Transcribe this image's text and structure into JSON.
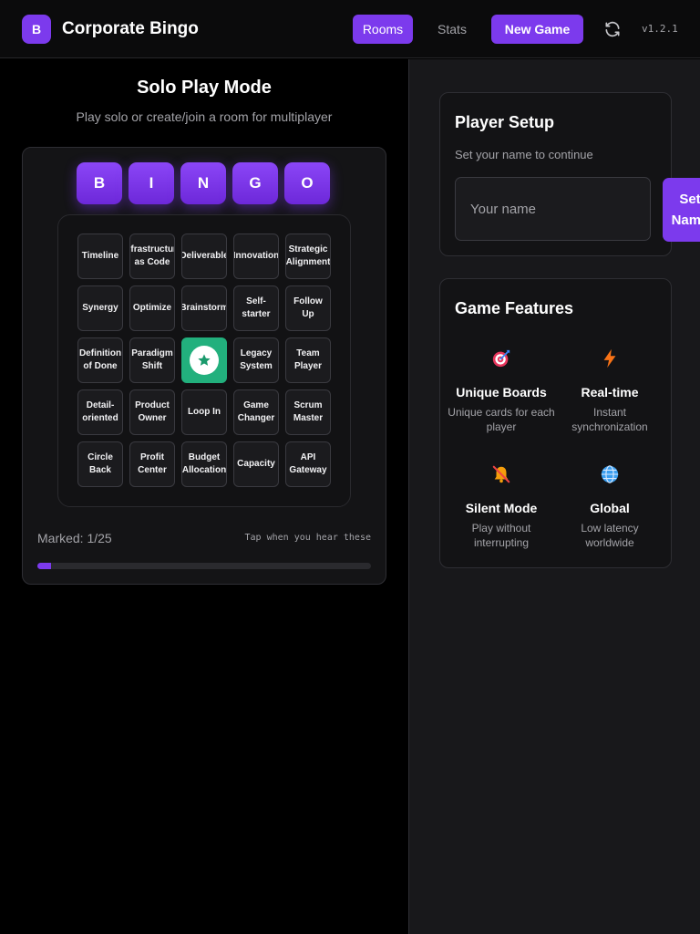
{
  "header": {
    "logo_letter": "B",
    "app_title": "Corporate Bingo",
    "nav_rooms": "Rooms",
    "nav_stats": "Stats",
    "new_game": "New Game",
    "refresh_icon": "refresh-icon",
    "version": "v1.2.1"
  },
  "solo": {
    "title": "Solo Play Mode",
    "subtitle": "Play solo or create/join a room for multiplayer",
    "letters": [
      "B",
      "I",
      "N",
      "G",
      "O"
    ],
    "cells": [
      "Timeline",
      "Infrastructure as Code",
      "Deliverable",
      "Innovation",
      "Strategic Alignment",
      "Synergy",
      "Optimize",
      "Brainstorm",
      "Self-starter",
      "Follow Up",
      "Definition of Done",
      "Paradigm Shift",
      "",
      "Legacy System",
      "Team Player",
      "Detail-oriented",
      "Product Owner",
      "Loop In",
      "Game Changer",
      "Scrum Master",
      "Circle Back",
      "Profit Center",
      "Budget Allocation",
      "Capacity",
      "API Gateway"
    ],
    "free_icon": "star-icon",
    "marked": "Marked: 1/25",
    "progress_fraction": 0.04,
    "tap_hint": "Tap when you hear these"
  },
  "player_setup": {
    "title": "Player Setup",
    "subtitle": "Set your name to continue",
    "name_placeholder": "Your name",
    "set_name_button": "Set Name"
  },
  "features": {
    "title": "Game Features",
    "items": [
      {
        "icon": "target-icon",
        "name": "Unique Boards",
        "desc": "Unique cards for each player"
      },
      {
        "icon": "lightning-icon",
        "name": "Real-time",
        "desc": "Instant synchronization"
      },
      {
        "icon": "muted-bell-icon",
        "name": "Silent Mode",
        "desc": "Play without interrupting"
      },
      {
        "icon": "globe-icon",
        "name": "Global",
        "desc": "Low latency worldwide"
      }
    ]
  },
  "colors": {
    "accent": "#7c3aed",
    "free_cell": "#22b07d",
    "background": "#000000",
    "panel": "#18181b"
  }
}
